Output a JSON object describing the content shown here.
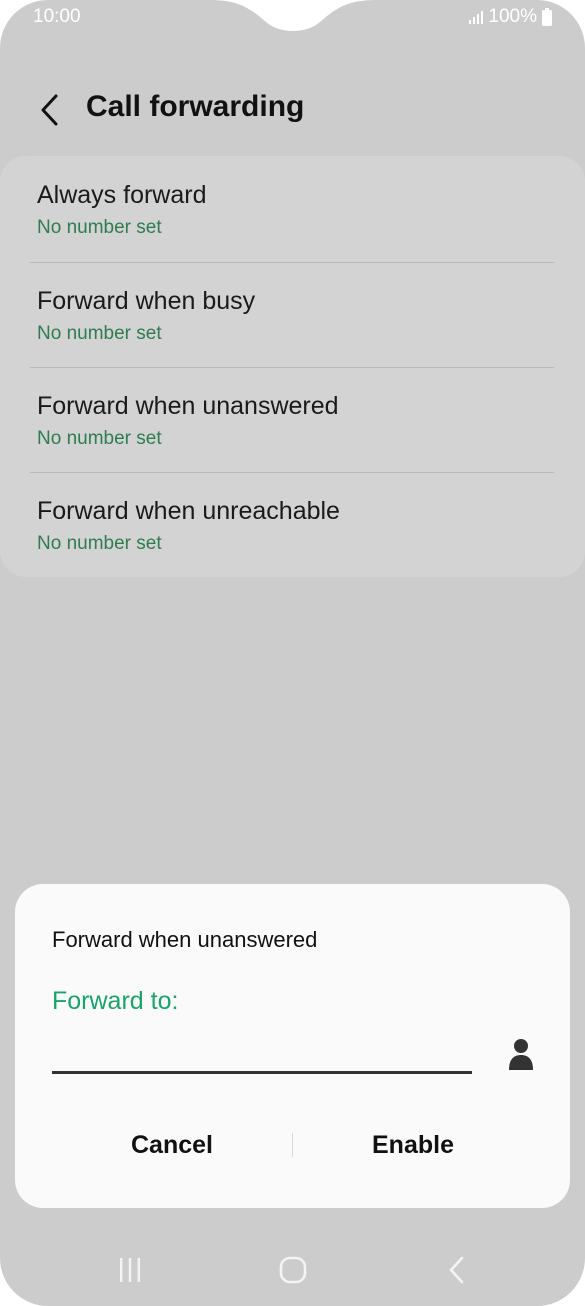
{
  "status_bar": {
    "time": "10:00",
    "battery": "100%",
    "signal_icon": "signal-icon",
    "battery_icon": "battery-icon"
  },
  "header": {
    "back_icon": "chevron-left-icon",
    "title": "Call forwarding"
  },
  "list": {
    "items": [
      {
        "label": "Always forward",
        "value": "No number set"
      },
      {
        "label": "Forward when busy",
        "value": "No number set"
      },
      {
        "label": "Forward when unanswered",
        "value": "No number set"
      },
      {
        "label": "Forward when unreachable",
        "value": "No number set"
      }
    ]
  },
  "dialog": {
    "title": "Forward when unanswered",
    "field_label": "Forward to:",
    "field_value": "",
    "contact_icon": "contact-person-icon",
    "cancel_label": "Cancel",
    "enable_label": "Enable"
  },
  "navigation": {
    "recents_icon": "recents-icon",
    "home_icon": "home-icon",
    "back_icon": "back-icon"
  },
  "colors": {
    "background": "#cccccc",
    "card": "#d3d3d3",
    "accent_green": "#1aa36b",
    "subtitle_green": "#2e7d50",
    "dialog_bg": "#fafafa"
  }
}
